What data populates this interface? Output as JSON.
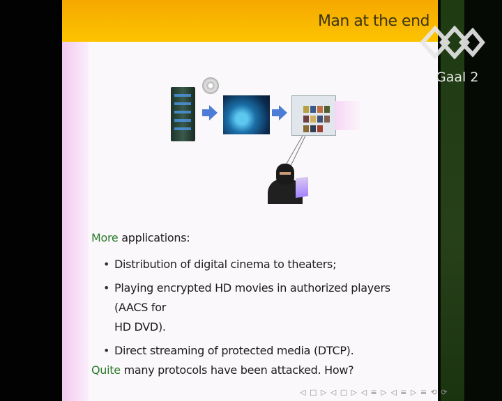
{
  "slide": {
    "title": "Man at the end",
    "intro_accent": "More",
    "intro_rest": " applications:",
    "bullets": [
      "Distribution of digital cinema to theaters;",
      "Playing encrypted HD movies in authorized players (AACS for",
      "HD DVD).",
      "Direct streaming of protected media (DTCP)."
    ],
    "outro_accent": "Quite",
    "outro_rest": " many protocols have been attacked. How?"
  },
  "channel": {
    "logo_text": "Gaal 2"
  },
  "nav": {
    "symbols": "◁ □ ▷ ◁ ▢ ▷ ◁ ≡ ▷ ◁ ≡ ▷  ≡  ⟲ ⟳"
  },
  "colors": {
    "header": "#fcc400",
    "accent": "#2b7a2b",
    "slide_bg": "#fbf8fb"
  }
}
